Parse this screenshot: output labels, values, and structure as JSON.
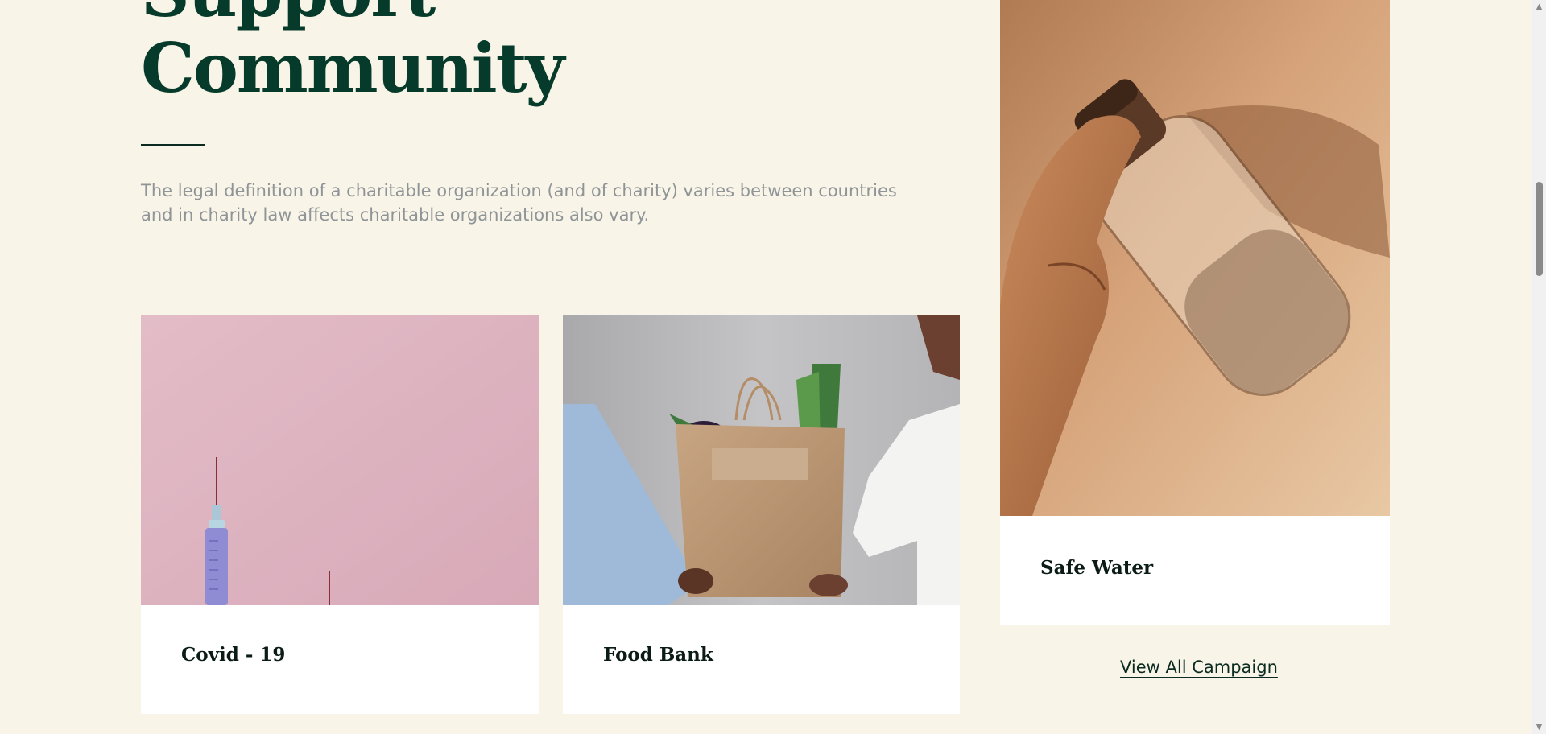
{
  "heading": {
    "line1": "Support",
    "line2": "Community"
  },
  "intro": {
    "text": "The legal definition of a charitable organization (and of charity) varies between countries and in charity law affects charitable organizations also vary."
  },
  "campaigns": [
    {
      "title": "Covid - 19",
      "photo": "syringe-photo"
    },
    {
      "title": "Food Bank",
      "photo": "grocery-bag-photo"
    },
    {
      "title": "Safe Water",
      "photo": "water-bottle-photo"
    }
  ],
  "view_all": {
    "label": "View All Campaign"
  },
  "scrollbar": {
    "up_icon": "▲",
    "down_icon": "▼"
  },
  "colors": {
    "background": "#f8f4e8",
    "heading": "#063b2b",
    "body_text": "#8f9497",
    "card": "#ffffff"
  }
}
